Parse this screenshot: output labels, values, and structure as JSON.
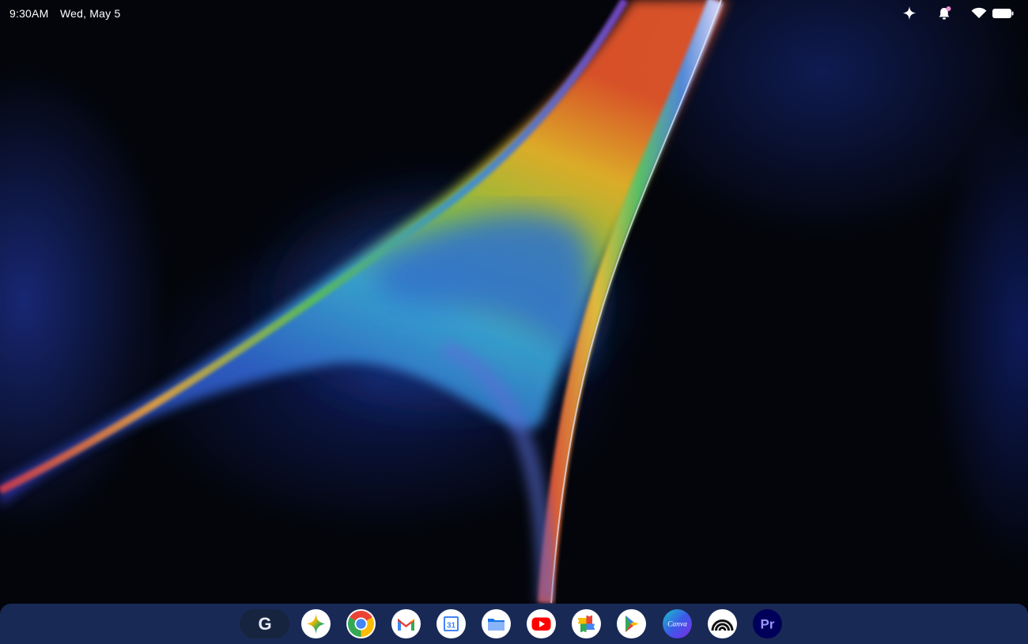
{
  "status_bar": {
    "time": "9:30AM",
    "date": "Wed, May 5",
    "icons": [
      "sparkle-icon",
      "notification-bell-icon",
      "wifi-icon",
      "battery-icon"
    ]
  },
  "shelf": {
    "launcher_label": "G",
    "apps": [
      {
        "name": "gemini-app-icon",
        "label": ""
      },
      {
        "name": "chrome-app-icon",
        "label": ""
      },
      {
        "name": "gmail-app-icon",
        "label": ""
      },
      {
        "name": "calendar-app-icon",
        "label": "31"
      },
      {
        "name": "files-app-icon",
        "label": ""
      },
      {
        "name": "youtube-app-icon",
        "label": ""
      },
      {
        "name": "photos-app-icon",
        "label": ""
      },
      {
        "name": "play-store-app-icon",
        "label": ""
      },
      {
        "name": "canva-app-icon",
        "label": "Canva"
      },
      {
        "name": "rainbow-app-icon",
        "label": ""
      },
      {
        "name": "premiere-pro-app-icon",
        "label": "Pr"
      }
    ]
  },
  "colors": {
    "shelf_background": "#1a2c5c",
    "launcher_background": "#17243f",
    "accent_blue": "#4285f4",
    "accent_red": "#ea4335",
    "accent_yellow": "#fbbc04",
    "accent_green": "#34a853"
  }
}
